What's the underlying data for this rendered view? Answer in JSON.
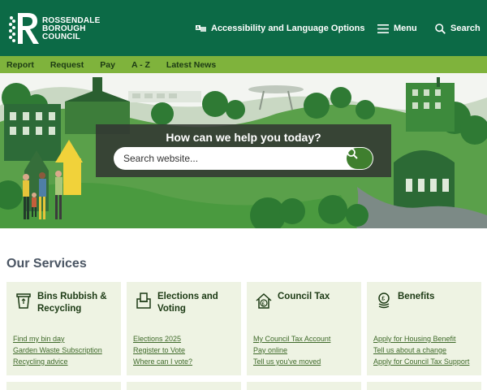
{
  "header": {
    "logo_lines": [
      "Rossendale",
      "Borough",
      "Council"
    ],
    "accessibility_label": "Accessibility and Language Options",
    "menu_label": "Menu",
    "search_label": "Search"
  },
  "nav": {
    "items": [
      "Report",
      "Request",
      "Pay",
      "A - Z",
      "Latest News"
    ]
  },
  "hero": {
    "title": "How can we help you today?",
    "search_placeholder": "Search website..."
  },
  "services": {
    "title": "Our Services",
    "cards": [
      {
        "title": "Bins Rubbish & Recycling",
        "icon": "bin-icon",
        "links": [
          "Find my bin day",
          "Garden Waste Subscription",
          "Recycling advice"
        ]
      },
      {
        "title": "Elections and Voting",
        "icon": "ballot-box-icon",
        "links": [
          "Elections 2025",
          "Register to Vote",
          "Where can I vote?"
        ]
      },
      {
        "title": "Council Tax",
        "icon": "house-pound-icon",
        "links": [
          "My Council Tax Account",
          "Pay online",
          "Tell us you've moved"
        ]
      },
      {
        "title": "Benefits",
        "icon": "coins-pound-icon",
        "links": [
          "Apply for Housing Benefit",
          "Tell us about a change",
          "Apply for Council Tax Support"
        ]
      }
    ]
  },
  "colors": {
    "header_green": "#0c6a46",
    "nav_green": "#7fb33c",
    "card_bg": "#eef3e3",
    "link_green": "#3f6a2a"
  }
}
